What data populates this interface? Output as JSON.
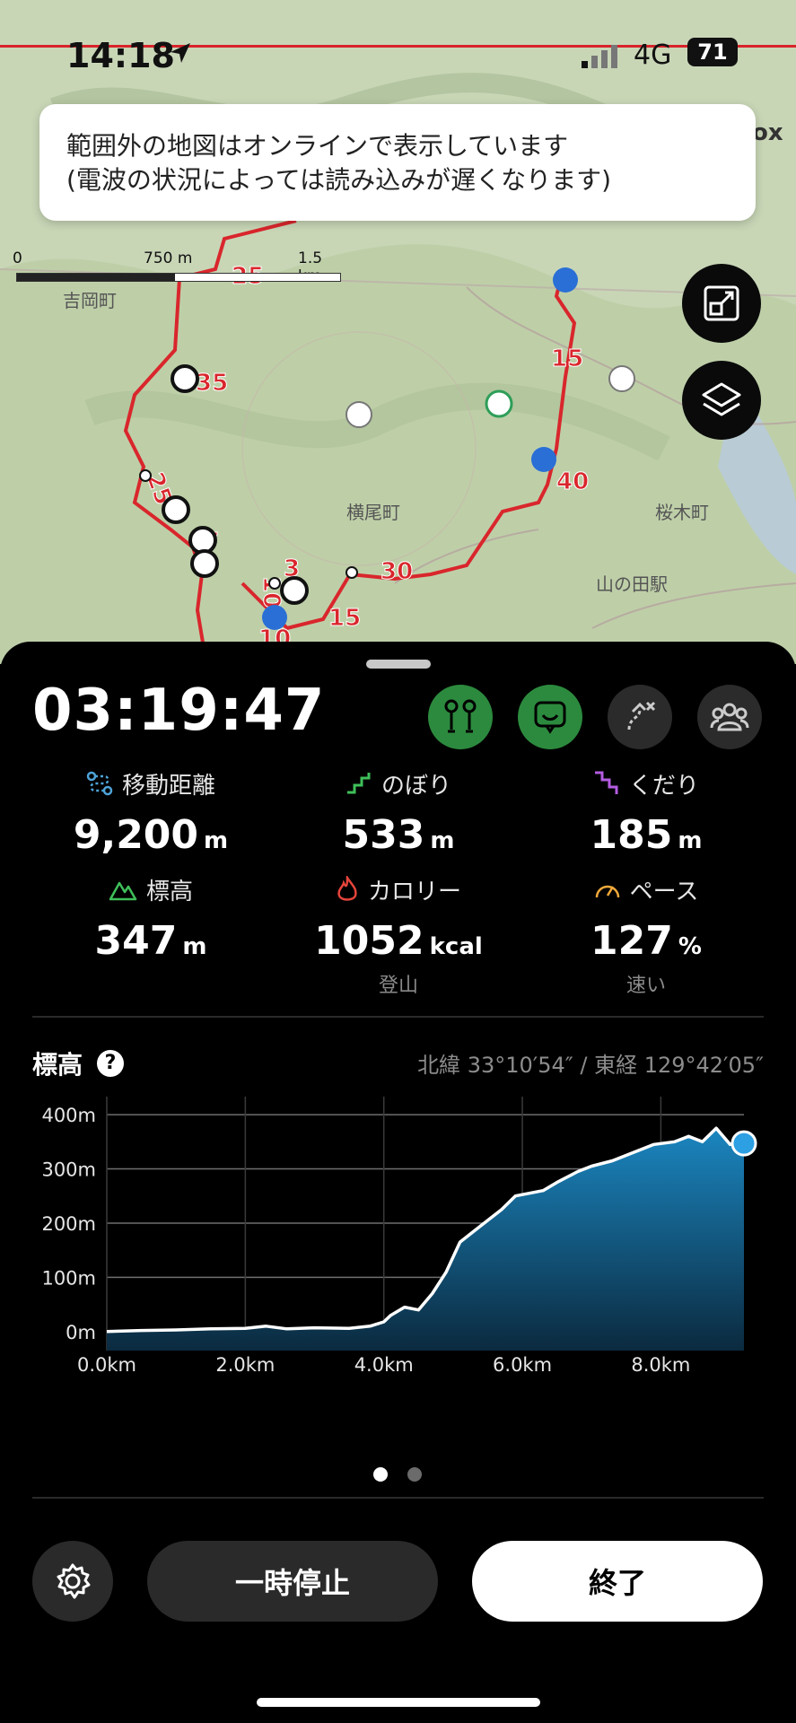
{
  "status": {
    "time": "14:18",
    "network": "4G",
    "battery": "71"
  },
  "map": {
    "toast_line1": "範囲外の地図はオンラインで表示しています",
    "toast_line2": "(電波の状況によっては読み込みが遅くなります)",
    "scale": {
      "zero": "0",
      "mid": "750 m",
      "end": "1.5 km"
    },
    "place_labels": [
      "吉岡町",
      "横尾町",
      "桜木町",
      "山の田駅"
    ],
    "route_markers": [
      "25",
      "35",
      "25",
      "15",
      "40",
      "30",
      "15",
      "10",
      "3",
      "10",
      "7"
    ],
    "fit_button_icon": "fit-bounds-icon",
    "layers_button_icon": "layers-icon"
  },
  "activity": {
    "elapsed": "03:19:47",
    "buttons": [
      "map-pins-icon",
      "chat-icon",
      "route-off-icon",
      "group-icon"
    ],
    "stats": {
      "distance": {
        "label": "移動距離",
        "value": "9,200",
        "unit": "m"
      },
      "ascent": {
        "label": "のぼり",
        "value": "533",
        "unit": "m"
      },
      "descent": {
        "label": "くだり",
        "value": "185",
        "unit": "m"
      },
      "elevation": {
        "label": "標高",
        "value": "347",
        "unit": "m"
      },
      "calories": {
        "label": "カロリー",
        "value": "1052",
        "unit": "kcal",
        "sub": "登山"
      },
      "pace": {
        "label": "ペース",
        "value": "127",
        "unit": "%",
        "sub": "速い"
      }
    }
  },
  "elevation_section": {
    "title": "標高",
    "coords": "北緯 33°10′54″ / 東経 129°42′05″"
  },
  "chart_data": {
    "type": "area",
    "title": "標高",
    "xlabel": "",
    "ylabel": "",
    "x_ticks": [
      "0.0km",
      "2.0km",
      "4.0km",
      "6.0km",
      "8.0km"
    ],
    "y_ticks": [
      "0m",
      "100m",
      "200m",
      "300m",
      "400m"
    ],
    "xlim": [
      0,
      9.2
    ],
    "ylim": [
      -35,
      420
    ],
    "grid": true,
    "series": [
      {
        "x": [
          0,
          0.5,
          1.0,
          1.5,
          2.0,
          2.3,
          2.6,
          3.0,
          3.5,
          3.8,
          4.0,
          4.1,
          4.3,
          4.5,
          4.7,
          4.9,
          5.1,
          5.3,
          5.5,
          5.7,
          5.9,
          6.1,
          6.3,
          6.5,
          6.8,
          7.0,
          7.3,
          7.6,
          7.9,
          8.2,
          8.4,
          8.6,
          8.8,
          9.0,
          9.2
        ],
        "y": [
          0,
          2,
          3,
          5,
          6,
          10,
          5,
          7,
          6,
          10,
          18,
          30,
          45,
          40,
          70,
          110,
          165,
          185,
          205,
          225,
          250,
          255,
          260,
          275,
          295,
          305,
          315,
          330,
          345,
          350,
          360,
          350,
          375,
          345,
          347
        ]
      }
    ]
  },
  "pager": {
    "pages": 2,
    "active": 0
  },
  "controls": {
    "pause_label": "一時停止",
    "end_label": "終了",
    "settings_icon": "gear-icon"
  }
}
